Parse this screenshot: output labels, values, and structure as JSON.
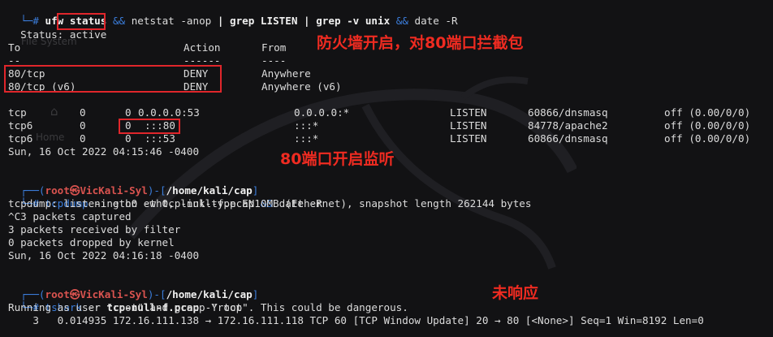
{
  "terminal": {
    "cmd1": {
      "prefix": "└─# ",
      "ufw": "ufw",
      "status": " status ",
      "amp1": "&&",
      "netstat": " netstat -anop ",
      "pipe1": "|",
      "grep1": " grep LISTEN ",
      "pipe2": "|",
      "grep2": " grep -v unix ",
      "amp2": "&&",
      "date": " date -R"
    },
    "status_label": "Status: ",
    "status_value": "active",
    "ufw_headers": {
      "to": "To",
      "action": "Action",
      "from": "From"
    },
    "ufw_dividers": {
      "to": "--",
      "action": "------",
      "from": "----"
    },
    "ufw_rules": [
      {
        "to": "80/tcp",
        "action": "DENY",
        "from": "Anywhere"
      },
      {
        "to": "80/tcp (v6)",
        "action": "DENY",
        "from": "Anywhere (v6)"
      }
    ],
    "netstat_rows": [
      {
        "proto": "tcp",
        "recv": "0",
        "send": "0",
        "local": "0.0.0.0:53",
        "foreign": "0.0.0.0:*",
        "state": "LISTEN",
        "prog": "60866/dnsmasq",
        "timer": "off (0.00/0/0)"
      },
      {
        "proto": "tcp6",
        "recv": "0",
        "send": "0",
        "local": ":::80",
        "foreign": ":::*",
        "state": "LISTEN",
        "prog": "84778/apache2",
        "timer": "off (0.00/0/0)"
      },
      {
        "proto": "tcp6",
        "recv": "0",
        "send": "0",
        "local": ":::53",
        "foreign": ":::*",
        "state": "LISTEN",
        "prog": "60866/dnsmasq",
        "timer": "off (0.00/0/0)"
      }
    ],
    "date1": "Sun, 16 Oct 2022 04:15:46 -0400",
    "prompt2": {
      "top": "┌──(",
      "user": "root㉿VicKali-Syl",
      "mid": ")-[",
      "path": "/home/kali/cap",
      "end": "]"
    },
    "cmd2": {
      "prefix": "└─# ",
      "tcpdump": "tcpdump",
      "args": " -i eth0 -w tcp-null-f.pcap ",
      "amp": "&&",
      "date": " date -R"
    },
    "tcpdump_out": [
      "tcpdump: listening on eth0, link-type EN10MB (Ethernet), snapshot length 262144 bytes",
      "^C3 packets captured",
      "3 packets received by filter",
      "0 packets dropped by kernel",
      "Sun, 16 Oct 2022 04:16:18 -0400"
    ],
    "prompt3": {
      "top": "┌──(",
      "user": "root㉿VicKali-Syl",
      "mid": ")-[",
      "path": "/home/kali/cap",
      "end": "]"
    },
    "cmd3": {
      "prefix": "└─# ",
      "tshark": "tshark",
      "r": " -r ",
      "file": "tcp-null-f.pcap",
      "y": " -Y tcp"
    },
    "tshark_out": [
      "Running as user \"root\" and group \"root\". This could be dangerous.",
      "    3   0.014935 172.16.111.138 → 172.16.111.118 TCP 60 [TCP Window Update] 20 → 80 [<None>] Seq=1 Win=8192 Len=0"
    ]
  },
  "annotations": {
    "firewall_note": "防火墙开启，对80端口拦截包",
    "port_note": "80端口开启监听",
    "noresp_note": "未响应"
  },
  "desktop_ghost": {
    "filesystem": "File System",
    "home": "Home"
  },
  "colors": {
    "background": "#121214",
    "prompt_blue": "#3b7ddb",
    "user_red": "#d9534f",
    "highlight_box": "#e0262b",
    "annotation_red": "#ef2b21"
  }
}
